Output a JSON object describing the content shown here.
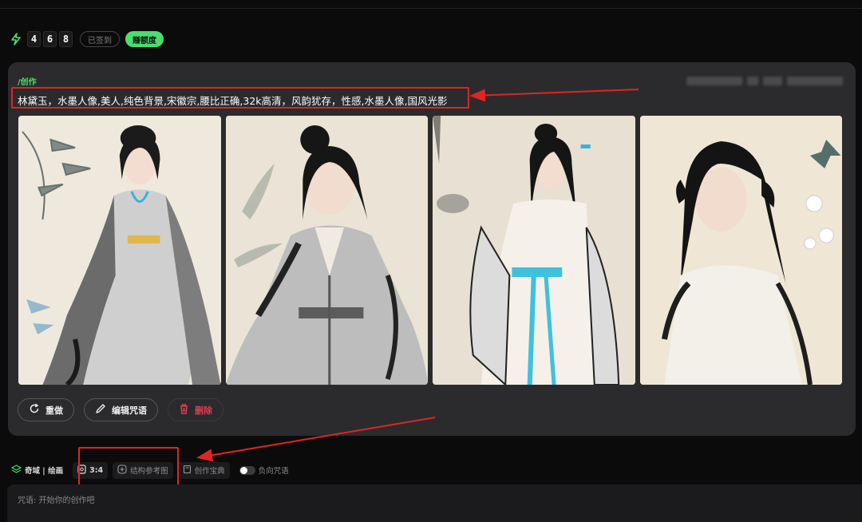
{
  "credits": {
    "digits": [
      "4",
      "6",
      "8"
    ],
    "signed_label": "已签到",
    "earn_label": "赚额度"
  },
  "card": {
    "label": "/创作",
    "prompt": "林黛玉，水墨人像,美人,纯色背景,宋徽宗,腰比正确,32k高清，风韵犹存，性感,水墨人像,国风光影",
    "images": [
      {
        "icon": "ink-portrait-image-1"
      },
      {
        "icon": "ink-portrait-image-2"
      },
      {
        "icon": "ink-portrait-image-3"
      },
      {
        "icon": "ink-portrait-image-4"
      }
    ],
    "actions": {
      "redo": "重做",
      "edit": "编辑咒语",
      "delete": "删除"
    }
  },
  "toolbar": {
    "model": "奇域 | 绘画",
    "ratio": "3:4",
    "structure_ref": "结构参考图",
    "creation_book": "创作宝典",
    "negative_prompt": "负向咒语"
  },
  "input": {
    "placeholder": "咒语: 开始你的创作吧"
  },
  "colors": {
    "accent": "#4ade6e",
    "annotation": "#e02424",
    "delete": "#e23b52"
  }
}
